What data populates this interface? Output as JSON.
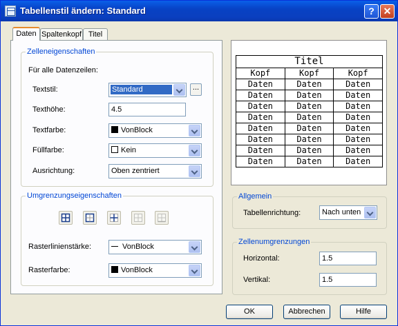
{
  "window": {
    "title": "Tabellenstil ändern: Standard",
    "help_label": "?",
    "close_label": "✕"
  },
  "tabs": [
    {
      "label": "Daten",
      "active": true
    },
    {
      "label": "Spaltenkopf",
      "active": false
    },
    {
      "label": "Titel",
      "active": false
    }
  ],
  "cell_props": {
    "title": "Zelleneigenschaften",
    "for_all_rows": "Für alle Datenzeilen:",
    "textstil": {
      "label": "Textstil:",
      "value": "Standard",
      "dots": "..."
    },
    "texthoehe": {
      "label": "Texthöhe:",
      "value": "4.5"
    },
    "textfarbe": {
      "label": "Textfarbe:",
      "value": "VonBlock"
    },
    "fuellfarbe": {
      "label": "Füllfarbe:",
      "value": "Kein"
    },
    "ausrichtung": {
      "label": "Ausrichtung:",
      "value": "Oben zentriert"
    }
  },
  "border_props": {
    "title": "Umgrenzungseigenschaften",
    "buttons": [
      "all-borders",
      "outside-borders",
      "inside-borders",
      "no-borders",
      "bottom-border"
    ],
    "lineweight": {
      "label": "Rasterlinienstärke:",
      "value": "VonBlock"
    },
    "gridcolor": {
      "label": "Rasterfarbe:",
      "value": "VonBlock"
    }
  },
  "preview": {
    "title": "Titel",
    "headers": [
      "Kopf",
      "Kopf",
      "Kopf"
    ],
    "rows": [
      [
        "Daten",
        "Daten",
        "Daten"
      ],
      [
        "Daten",
        "Daten",
        "Daten"
      ],
      [
        "Daten",
        "Daten",
        "Daten"
      ],
      [
        "Daten",
        "Daten",
        "Daten"
      ],
      [
        "Daten",
        "Daten",
        "Daten"
      ],
      [
        "Daten",
        "Daten",
        "Daten"
      ],
      [
        "Daten",
        "Daten",
        "Daten"
      ],
      [
        "Daten",
        "Daten",
        "Daten"
      ]
    ]
  },
  "general": {
    "title": "Allgemein",
    "direction": {
      "label": "Tabellenrichtung:",
      "value": "Nach unten"
    }
  },
  "margins": {
    "title": "Zellenumgrenzungen",
    "horizontal": {
      "label": "Horizontal:",
      "value": "1.5"
    },
    "vertical": {
      "label": "Vertikal:",
      "value": "1.5"
    }
  },
  "footer": {
    "ok": "OK",
    "cancel": "Abbrechen",
    "help": "Hilfe"
  },
  "colors": {
    "title_bar": "#0842c4",
    "group_title": "#0046d5",
    "selection": "#316ac5",
    "tab_accent": "#e68b2c"
  }
}
